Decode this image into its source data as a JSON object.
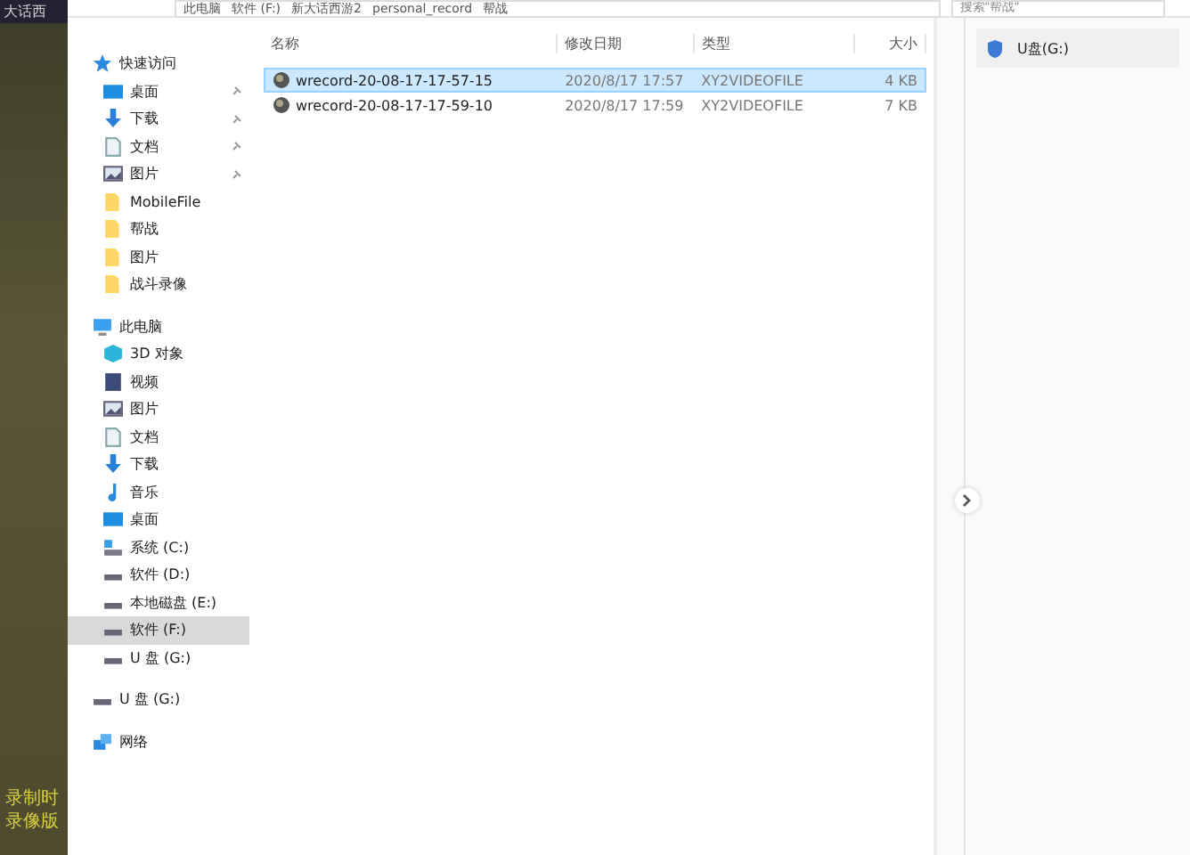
{
  "desktop": {
    "app_title": "大话西",
    "overlay_lines": [
      "录制时",
      "录像版"
    ]
  },
  "address_bar": {
    "crumbs": [
      "此电脑",
      "软件 (F:)",
      "新大话西游2",
      "personal_record",
      "帮战"
    ],
    "search_placeholder": "搜索\"帮战\""
  },
  "nav": [
    {
      "label": "快速访问",
      "kind": "header",
      "selected": false,
      "children": [
        {
          "label": "桌面",
          "kind": "desktop",
          "pinned": true,
          "selected": false
        },
        {
          "label": "下载",
          "kind": "download",
          "pinned": true,
          "selected": false
        },
        {
          "label": "文档",
          "kind": "document",
          "pinned": true,
          "selected": false
        },
        {
          "label": "图片",
          "kind": "picture",
          "pinned": true,
          "selected": false
        },
        {
          "label": "MobileFile",
          "kind": "folder",
          "pinned": false,
          "selected": false
        },
        {
          "label": "帮战",
          "kind": "folder",
          "pinned": false,
          "selected": false
        },
        {
          "label": "图片",
          "kind": "folder",
          "pinned": false,
          "selected": false
        },
        {
          "label": "战斗录像",
          "kind": "folder",
          "pinned": false,
          "selected": false
        }
      ]
    },
    {
      "label": "此电脑",
      "kind": "pc",
      "selected": false,
      "children": [
        {
          "label": "3D 对象",
          "kind": "cube",
          "pinned": false,
          "selected": false
        },
        {
          "label": "视频",
          "kind": "video",
          "pinned": false,
          "selected": false
        },
        {
          "label": "图片",
          "kind": "picture",
          "pinned": false,
          "selected": false
        },
        {
          "label": "文档",
          "kind": "document",
          "pinned": false,
          "selected": false
        },
        {
          "label": "下载",
          "kind": "download",
          "pinned": false,
          "selected": false
        },
        {
          "label": "音乐",
          "kind": "music",
          "pinned": false,
          "selected": false
        },
        {
          "label": "桌面",
          "kind": "desktop",
          "pinned": false,
          "selected": false
        },
        {
          "label": "系统 (C:)",
          "kind": "system",
          "pinned": false,
          "selected": false
        },
        {
          "label": "软件 (D:)",
          "kind": "drive",
          "pinned": false,
          "selected": false
        },
        {
          "label": "本地磁盘 (E:)",
          "kind": "drive",
          "pinned": false,
          "selected": false
        },
        {
          "label": "软件 (F:)",
          "kind": "drive",
          "pinned": false,
          "selected": true
        },
        {
          "label": "U 盘 (G:)",
          "kind": "drive",
          "pinned": false,
          "selected": false
        }
      ]
    },
    {
      "label": "U 盘 (G:)",
      "kind": "drive",
      "selected": false
    },
    {
      "label": "网络",
      "kind": "network",
      "selected": false
    }
  ],
  "table": {
    "columns": [
      "名称",
      "修改日期",
      "类型",
      "大小"
    ],
    "rows": [
      {
        "name": "wrecord-20-08-17-17-57-15",
        "date": "2020/8/17 17:57",
        "type": "XY2VIDEOFILE",
        "size": "4 KB",
        "selected": true
      },
      {
        "name": "wrecord-20-08-17-17-59-10",
        "date": "2020/8/17 17:59",
        "type": "XY2VIDEOFILE",
        "size": "7 KB",
        "selected": false
      }
    ]
  },
  "details_pane": {
    "drive_label": "U盘(G:)"
  }
}
